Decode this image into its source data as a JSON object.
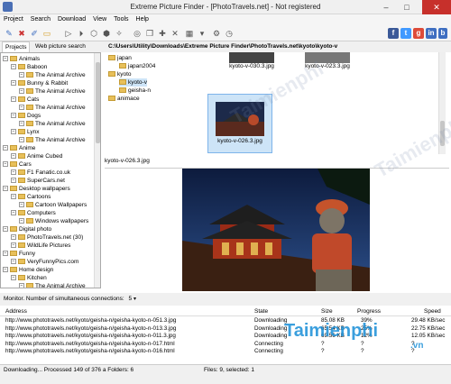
{
  "window": {
    "title": "Extreme Picture Finder - [PhotoTravels.net] - Not registered"
  },
  "menu": [
    "Project",
    "Search",
    "Download",
    "View",
    "Tools",
    "Help"
  ],
  "tabs": {
    "projects": "Projects",
    "web": "Web picture search"
  },
  "path": "C:\\Users\\Utility\\Downloads\\Extreme Picture Finder\\PhotoTravels.net\\kyoto\\kyoto-v",
  "tree": [
    {
      "label": "Animals",
      "level": 0
    },
    {
      "label": "Baboon",
      "level": 1
    },
    {
      "label": "The Animal Archive",
      "level": 2
    },
    {
      "label": "Bunny & Rabbit",
      "level": 1
    },
    {
      "label": "The Animal Archive",
      "level": 2
    },
    {
      "label": "Cats",
      "level": 1
    },
    {
      "label": "The Animal Archive",
      "level": 2
    },
    {
      "label": "Dogs",
      "level": 1
    },
    {
      "label": "The Animal Archive",
      "level": 2
    },
    {
      "label": "Lynx",
      "level": 1
    },
    {
      "label": "The Animal Archive",
      "level": 2
    },
    {
      "label": "Anime",
      "level": 0
    },
    {
      "label": "Anime Cubed",
      "level": 1
    },
    {
      "label": "Cars",
      "level": 0
    },
    {
      "label": "F1 Fanatic.co.uk",
      "level": 1
    },
    {
      "label": "SuperCars.net",
      "level": 1
    },
    {
      "label": "Desktop wallpapers",
      "level": 0
    },
    {
      "label": "Cartoons",
      "level": 1
    },
    {
      "label": "Cartoon Wallpapers",
      "level": 2
    },
    {
      "label": "Computers",
      "level": 1
    },
    {
      "label": "Windows wallpapers",
      "level": 2
    },
    {
      "label": "Digital photo",
      "level": 0
    },
    {
      "label": "PhotoTravels.net (30)",
      "level": 1
    },
    {
      "label": "WildLife Pictures",
      "level": 1
    },
    {
      "label": "Funny",
      "level": 0
    },
    {
      "label": "VeryFunnyPics.com",
      "level": 1
    },
    {
      "label": "Home design",
      "level": 0
    },
    {
      "label": "Kitchen",
      "level": 1
    },
    {
      "label": "The Animal Archive",
      "level": 2
    }
  ],
  "folders": [
    {
      "label": "japan",
      "level": 0
    },
    {
      "label": "japan2004",
      "level": 1
    },
    {
      "label": "kyoto",
      "level": 0
    },
    {
      "label": "kyoto-v",
      "level": 1
    },
    {
      "label": "geisha-n",
      "level": 1
    },
    {
      "label": "animace",
      "level": 0
    }
  ],
  "thumbnails": [
    {
      "label": "kyoto-v-030.3.jpg"
    },
    {
      "label": "kyoto-v-023.3.jpg"
    },
    {
      "label": "kyoto-v-026.3.jpg"
    }
  ],
  "preview": {
    "filename": "kyoto-v-026.3.jpg"
  },
  "monitor": {
    "label": "Monitor. Number of simultaneous connections:",
    "value": "5"
  },
  "downloads": {
    "headers": {
      "address": "Address",
      "state": "State",
      "size": "Size",
      "progress": "Progress",
      "speed": "Speed"
    },
    "rows": [
      {
        "address": "http://www.phototravels.net/kyoto/geisha-n/geisha-kyoto-n-051.3.jpg",
        "state": "Downloading",
        "size": "85.08 KB",
        "progress": "39%",
        "speed": "29.48 KB/sec"
      },
      {
        "address": "http://www.phototravels.net/kyoto/geisha-n/geisha-kyoto-n-013.3.jpg",
        "state": "Downloading",
        "size": "65.54 KB",
        "progress": "25%",
        "speed": "22.75 KB/sec"
      },
      {
        "address": "http://www.phototravels.net/kyoto/geisha-n/geisha-kyoto-n-011.3.jpg",
        "state": "Downloading",
        "size": "69.56 KB",
        "progress": "12%",
        "speed": "12.05 KB/sec"
      },
      {
        "address": "http://www.phototravels.net/kyoto/geisha-n/geisha-kyoto-n-017.html",
        "state": "Connecting",
        "size": "?",
        "progress": "?",
        "speed": "?"
      },
      {
        "address": "http://www.phototravels.net/kyoto/geisha-n/geisha-kyoto-n-016.html",
        "state": "Connecting",
        "size": "?",
        "progress": "?",
        "speed": "?"
      }
    ]
  },
  "status": {
    "left": "Downloading... Processed 149 of 376 a Folders: 6",
    "right": "Files: 9, selected: 1"
  },
  "watermark": {
    "brand": "Taimienphi",
    "tld": ".vn"
  },
  "colors": {
    "accent": "#3f6fc1",
    "close": "#c7302b",
    "selection": "#cde4f7"
  }
}
